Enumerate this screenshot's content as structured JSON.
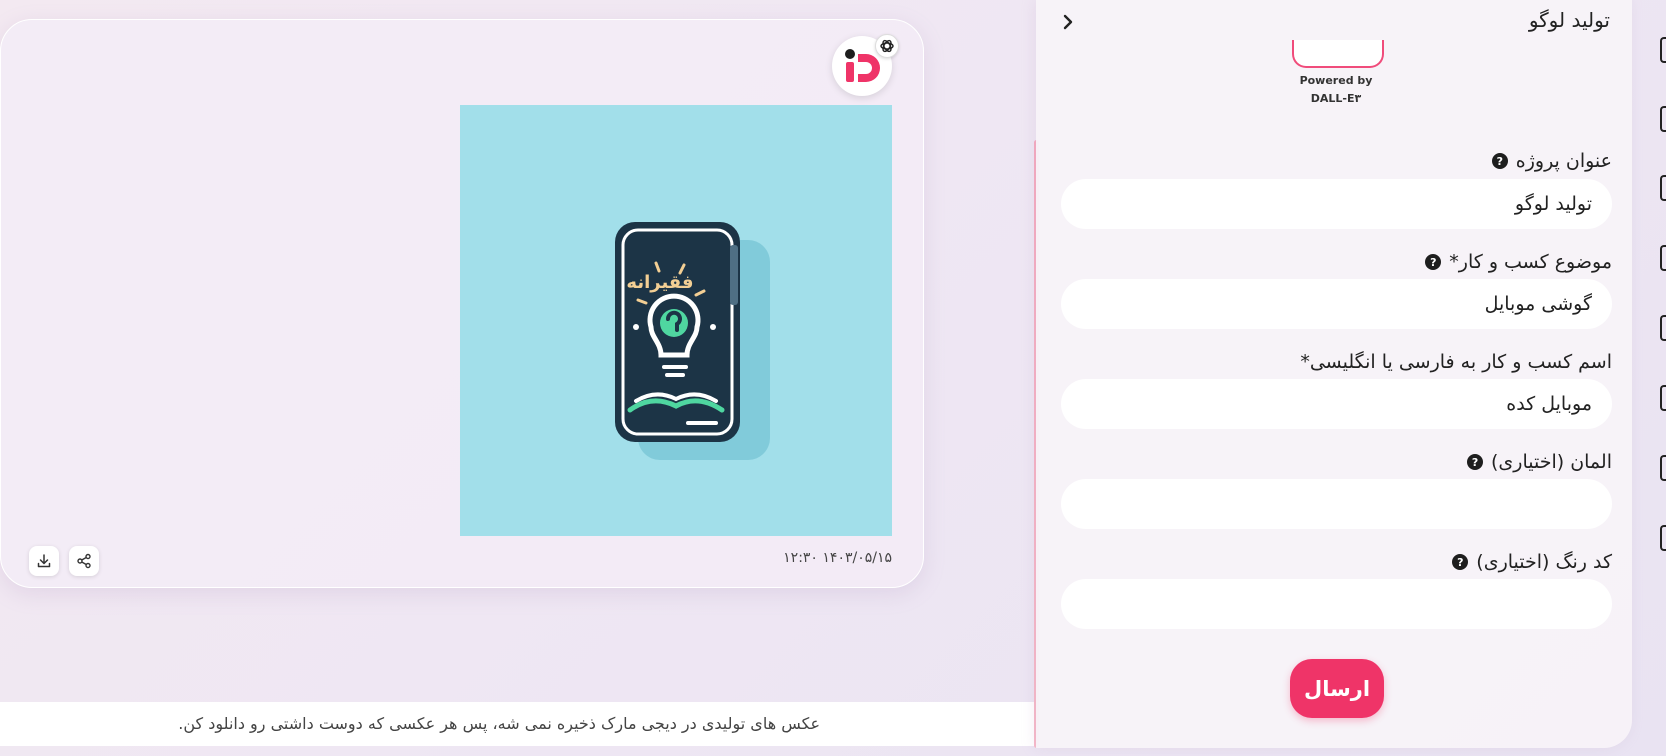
{
  "result": {
    "timestamp": "۱۴۰۳/۰۵/۱۵ ۱۲:۳۰",
    "image_alt": "تولید لوگو",
    "logo_text": "فقیرانه"
  },
  "notice": "عکس های تولیدی در دیجی مارک ذخیره نمی شه، پس هر عکسی که دوست داشتی رو دانلود کن.",
  "panel": {
    "title": "تولید لوگو",
    "powered_by": "Powered by",
    "powered_model": "DALL-E۳"
  },
  "form": {
    "project_title": {
      "label": "عنوان پروژه",
      "value": "تولید لوگو"
    },
    "business_topic": {
      "label": "موضوع کسب و کار*",
      "value": "گوشی موبایل"
    },
    "business_name": {
      "label": "اسم کسب و کار به فارسی یا انگلیسی*",
      "value": "موبایل کده"
    },
    "element": {
      "label": "المان (اختیاری)",
      "value": ""
    },
    "color_code": {
      "label": "کد رنگ (اختیاری)",
      "value": ""
    },
    "submit_label": "ارسال",
    "help_glyph": "?"
  },
  "colors": {
    "accent": "#ef3468",
    "image_bg": "#a2dfea",
    "phone_body": "#1c3446",
    "bulb_green": "#4fd6a0",
    "lettering": "#f3cf94"
  }
}
